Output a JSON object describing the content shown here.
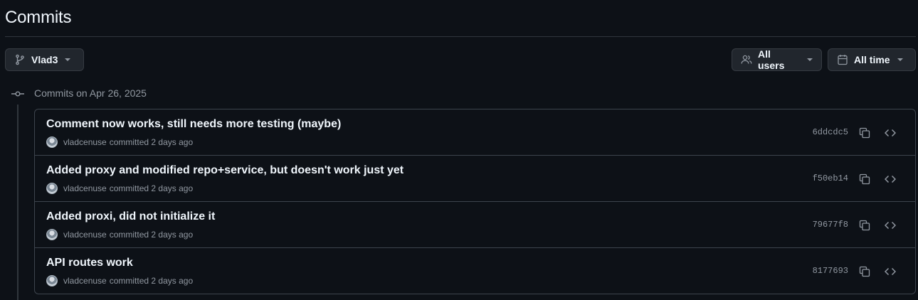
{
  "header": {
    "title": "Commits"
  },
  "filters": {
    "branch_label": "Vlad3",
    "users_label": "All users",
    "time_label": "All time"
  },
  "group": {
    "heading": "Commits on Apr 26, 2025"
  },
  "commits": [
    {
      "title": "Comment now works, still needs more testing (maybe)",
      "author": "vladcenuse",
      "meta": "committed 2 days ago",
      "sha": "6ddcdc5"
    },
    {
      "title": "Added proxy and modified repo+service, but doesn't work just yet",
      "author": "vladcenuse",
      "meta": "committed 2 days ago",
      "sha": "f50eb14"
    },
    {
      "title": "Added proxi, did not initialize it",
      "author": "vladcenuse",
      "meta": "committed 2 days ago",
      "sha": "79677f8"
    },
    {
      "title": "API routes work",
      "author": "vladcenuse",
      "meta": "committed 2 days ago",
      "sha": "8177693"
    }
  ],
  "icons": {
    "branch": "git-branch-icon",
    "users": "people-icon",
    "time": "calendar-icon",
    "group": "git-commit-icon",
    "copy": "copy-icon",
    "browse": "code-icon"
  },
  "colors": {
    "background": "#0d1117",
    "border": "#3d444d",
    "muted": "#9198a1",
    "button": "#21262d"
  }
}
